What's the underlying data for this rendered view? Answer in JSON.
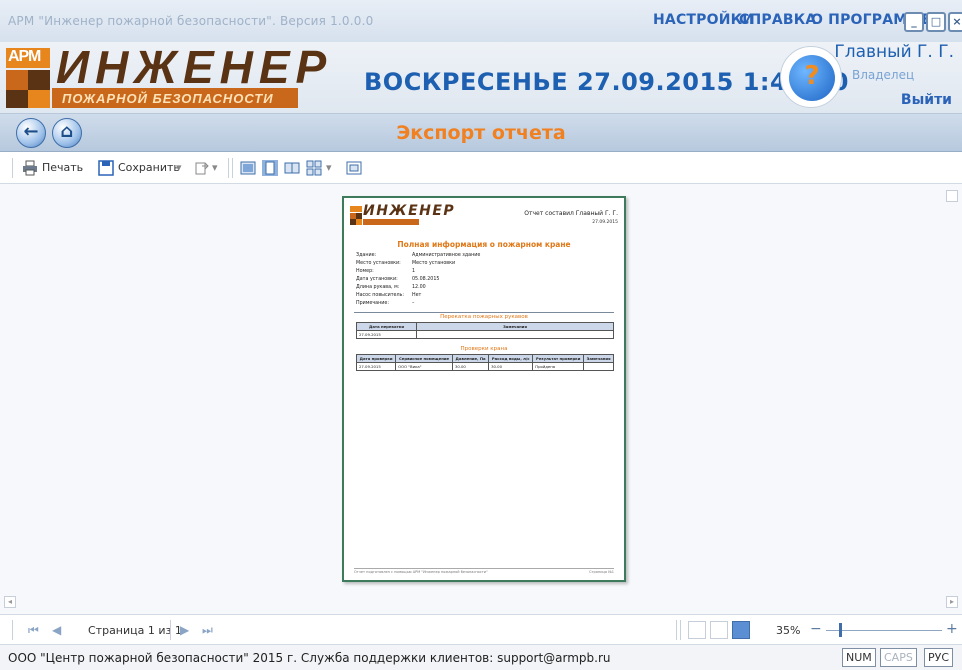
{
  "window": {
    "title": "АРМ \"Инженер пожарной безопасности\". Версия 1.0.0.0",
    "menu": [
      "НАСТРОЙКИ",
      "СПРАВКА",
      "О ПРОГРАММЕ"
    ],
    "controls": {
      "minimize": "_",
      "maximize": "□",
      "close": "×"
    }
  },
  "header": {
    "logo": {
      "arm": "АРМ",
      "big": "ИНЖЕНЕР",
      "sub": "ПОЖАРНОЙ БЕЗОПАСНОСТИ"
    },
    "datetime": "ВОСКРЕСЕНЬЕ 27.09.2015 1:48:50",
    "help_icon": "question-icon",
    "user": {
      "name": "Главный Г. Г.",
      "role": "Владелец",
      "logout": "Выйти"
    }
  },
  "nav": {
    "back_icon": "arrow-left-icon",
    "home_icon": "home-icon",
    "title": "Экспорт отчета"
  },
  "toolbar": {
    "print_label": "Печать",
    "save_label": "Сохранить",
    "dropdown_arrow": "▾"
  },
  "report": {
    "author": "Отчет составил Главный Г. Г.",
    "date": "27.09.2015",
    "title": "Полная информация о пожарном кране",
    "fields": [
      {
        "key": "Здание:",
        "value": "Административное здание"
      },
      {
        "key": "Место установки:",
        "value": "Место установки"
      },
      {
        "key": "Номер:",
        "value": "1"
      },
      {
        "key": "Дата установки:",
        "value": "05.08.2015"
      },
      {
        "key": "Длина рукава, м:",
        "value": "12.00"
      },
      {
        "key": "Насос повыситель:",
        "value": "Нет"
      },
      {
        "key": "Примечание:",
        "value": "–"
      }
    ],
    "section1": "Перекатка пожарных рукавов",
    "table1": {
      "headers": [
        "Дата перекатки",
        "Замечания"
      ],
      "rows": [
        [
          "27.09.2015",
          ""
        ]
      ]
    },
    "section2": "Проверки крана",
    "table2": {
      "headers": [
        "Дата проверки",
        "Сервисное помещение",
        "Давление, Па",
        "Расход воды, л/с",
        "Результат проверки",
        "Замечания"
      ],
      "rows": [
        [
          "27.09.2015",
          "ООО \"Вика\"",
          "30.00",
          "30.00",
          "Пройдена",
          ""
        ]
      ]
    },
    "footer_left": "Отчет подготовлен с помощью АРМ \"Инженер пожарной безопасности\"",
    "footer_right": "Страница №1"
  },
  "pager": {
    "label": "Страница 1 из 1",
    "zoom": "35%",
    "zoom_fraction": 0.12
  },
  "status": {
    "text": "ООО \"Центр пожарной безопасности\" 2015 г. Служба поддержки клиентов: support@armpb.ru",
    "indicators": [
      {
        "label": "NUM",
        "on": true
      },
      {
        "label": "CAPS",
        "on": false
      },
      {
        "label": "РУС",
        "on": true
      }
    ]
  }
}
